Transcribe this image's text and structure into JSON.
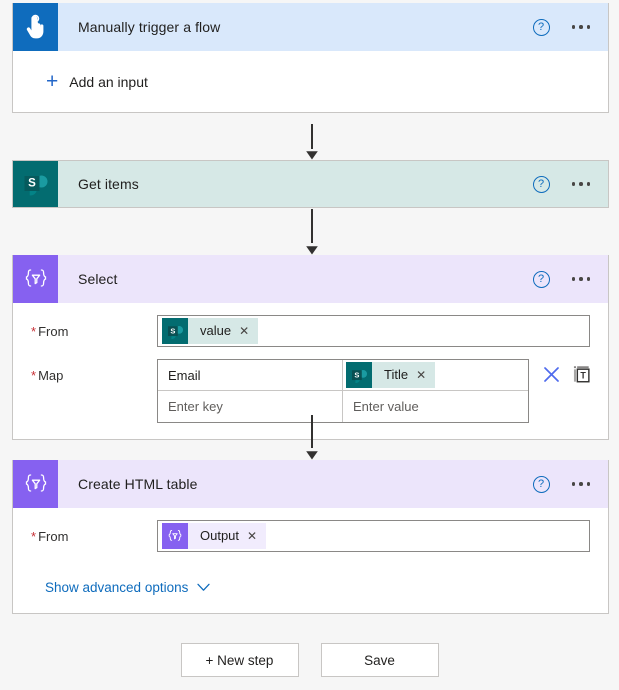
{
  "flow": {
    "trigger": {
      "title": "Manually trigger a flow",
      "icon": "touch-hand-icon",
      "accent": "#0f6cbd",
      "header_bg": "#d9e8fb",
      "add_input_label": "Add an input",
      "add_input_glyph": "+",
      "help_glyph": "?",
      "menu_glyph": "..."
    },
    "steps": [
      {
        "id": "get-items",
        "title": "Get items",
        "icon": "sharepoint-icon",
        "accent": "#036c70",
        "header_bg": "#d6e8e6",
        "help_glyph": "?",
        "menu_glyph": "..."
      },
      {
        "id": "select",
        "title": "Select",
        "icon": "data-operation-icon",
        "accent": "#8661f0",
        "header_bg": "#ece5fb",
        "help_glyph": "?",
        "menu_glyph": "...",
        "fields": {
          "from": {
            "label": "From",
            "required_marker": "*",
            "token": {
              "text": "value",
              "remove_glyph": "✕",
              "source": "sharepoint-icon"
            }
          },
          "map": {
            "label": "Map",
            "required_marker": "*",
            "rows": [
              {
                "key": "Email",
                "value_token": {
                  "text": "Title",
                  "remove_glyph": "✕",
                  "source": "sharepoint-icon"
                }
              },
              {
                "key_placeholder": "Enter key",
                "value_placeholder": "Enter value"
              }
            ],
            "tools": [
              {
                "name": "delete-map-row-icon",
                "glyph": "✕"
              },
              {
                "name": "switch-text-mode-icon",
                "glyph": "T"
              }
            ]
          }
        }
      },
      {
        "id": "create-html-table",
        "title": "Create HTML table",
        "icon": "data-operation-icon",
        "accent": "#8661f0",
        "header_bg": "#ece5fb",
        "help_glyph": "?",
        "menu_glyph": "...",
        "fields": {
          "from": {
            "label": "From",
            "required_marker": "*",
            "token": {
              "text": "Output",
              "remove_glyph": "✕",
              "source": "data-operation-icon"
            }
          }
        },
        "advanced": {
          "label": "Show advanced options",
          "chevron": "chevron-down-icon"
        }
      }
    ]
  },
  "footer": {
    "new_step_label": "+ New step",
    "save_label": "Save"
  },
  "theme": {
    "page_bg": "#f6f6f6",
    "card_bg": "#ffffff",
    "border": "#c8c6c4",
    "link": "#0f6cbd",
    "required": "#c62f35",
    "connector": "#323130"
  }
}
